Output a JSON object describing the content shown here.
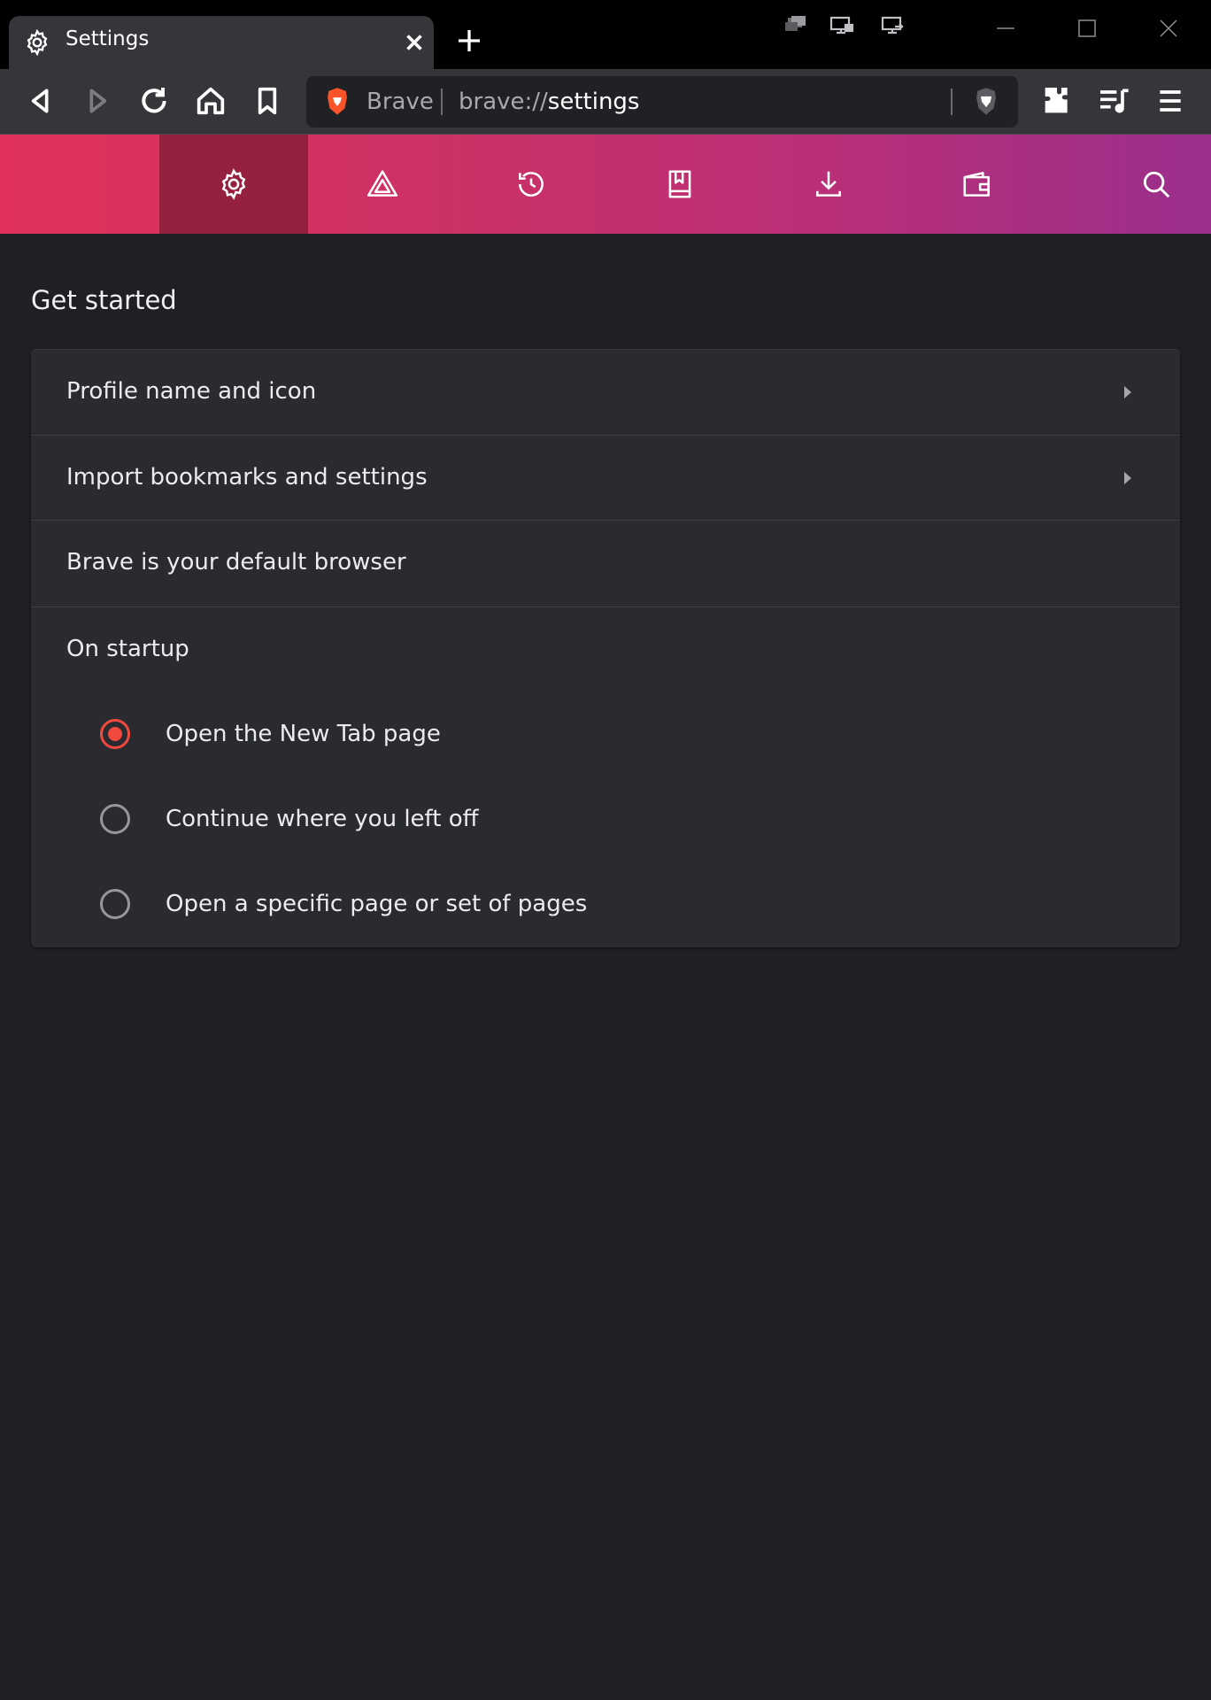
{
  "window": {
    "tab_title": "Settings",
    "tab_icon": "gear-icon",
    "system_icons": [
      "cascade-windows-icon",
      "monitor-icon",
      "monitor-switch-icon"
    ],
    "controls": [
      "minimize-icon",
      "maximize-icon",
      "close-icon"
    ]
  },
  "toolbar": {
    "buttons": [
      "back-icon",
      "forward-icon",
      "reload-icon",
      "home-icon",
      "bookmark-icon"
    ],
    "omnibox": {
      "brand": "Brave",
      "url_scheme": "brave://",
      "url_host": "settings"
    },
    "right_buttons": [
      "brave-shields-icon",
      "extensions-icon",
      "media-queue-icon",
      "menu-icon"
    ]
  },
  "settings_nav": {
    "items": [
      "gear-icon",
      "rewards-icon",
      "history-icon",
      "bookmarks-icon",
      "downloads-icon",
      "wallet-icon",
      "search-icon"
    ],
    "active": "gear-icon"
  },
  "main": {
    "section_title": "Get started",
    "rows": [
      {
        "label": "Profile name and icon",
        "has_arrow": true
      },
      {
        "label": "Import bookmarks and settings",
        "has_arrow": true
      },
      {
        "label": "Brave is your default browser",
        "has_arrow": false
      }
    ],
    "startup": {
      "heading": "On startup",
      "options": [
        {
          "label": "Open the New Tab page",
          "checked": true
        },
        {
          "label": "Continue where you left off",
          "checked": false
        },
        {
          "label": "Open a specific page or set of pages",
          "checked": false
        }
      ]
    }
  },
  "colors": {
    "accent": "#f2493e",
    "nav_gradient_start": "#e0325a",
    "nav_gradient_end": "#9a2f8c",
    "nav_active": "#95213f",
    "background": "#1e2025",
    "card": "#2a2b31"
  }
}
